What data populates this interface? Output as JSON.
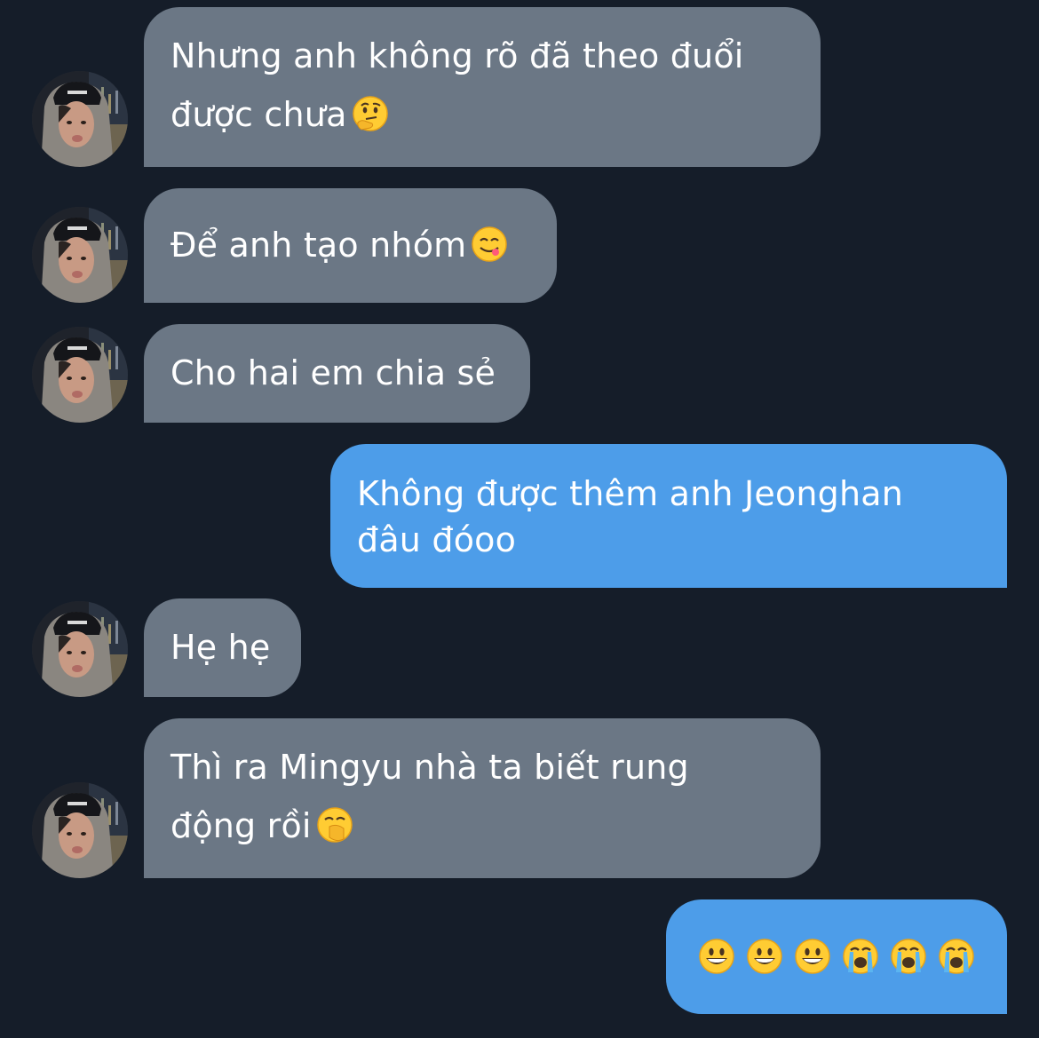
{
  "conversation": {
    "colors": {
      "background": "#151d29",
      "incoming_bubble": "#6b7785",
      "outgoing_bubble": "#4d9de9",
      "text": "#ffffff"
    },
    "messages": [
      {
        "direction": "incoming",
        "lines": [
          "Nhưng anh không rõ đã theo đuổi",
          "được chưa"
        ],
        "emoji": [
          "thinking-face"
        ]
      },
      {
        "direction": "incoming",
        "lines": [
          "Để anh tạo nhóm"
        ],
        "emoji": [
          "face-savoring-food"
        ]
      },
      {
        "direction": "incoming",
        "lines": [
          "Cho hai em chia sẻ"
        ],
        "emoji": []
      },
      {
        "direction": "outgoing",
        "lines": [
          "Không được thêm anh Jeonghan",
          "đâu đóoo"
        ],
        "emoji": []
      },
      {
        "direction": "incoming",
        "lines": [
          "Hẹ hẹ"
        ],
        "emoji": []
      },
      {
        "direction": "incoming",
        "lines": [
          "Thì ra Mingyu nhà ta biết rung",
          "động rồi"
        ],
        "emoji": [
          "yawning-face"
        ]
      },
      {
        "direction": "outgoing",
        "lines": [],
        "emoji": [
          "grinning-face",
          "grinning-face",
          "grinning-face",
          "loudly-crying-face",
          "loudly-crying-face",
          "loudly-crying-face"
        ]
      }
    ]
  }
}
